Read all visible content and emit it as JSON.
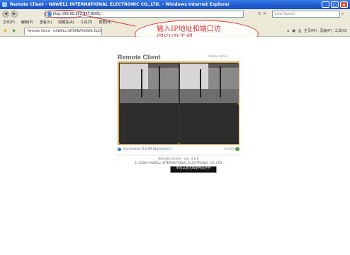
{
  "window": {
    "title": "Remote Client - HAWELL INTERNATIONAL ELECTRONIC CO.,LTD. - Windows Internet Explorer",
    "buttons": [
      "_",
      "□",
      "×"
    ]
  },
  "address": {
    "url": "http://58.60.252.247:8001/",
    "search_placeholder": "Live Search"
  },
  "menu": {
    "items": [
      "文件(F)",
      "编辑(E)",
      "查看(V)",
      "收藏夹(A)",
      "工具(T)",
      "帮助(H)"
    ]
  },
  "tab": {
    "label": "Remote Client - HAWELL INTERNATIONAL ELEC",
    "commands": [
      "主页(M)",
      "页面(P)",
      "工具(O)"
    ]
  },
  "annotation": {
    "line1": "输入IP地址和端口访",
    "line2": "问SVR主机。"
  },
  "page": {
    "title": "Remote Client",
    "links": "Admin  ⚙ Lo",
    "caption": "单击以激活和使用此控件",
    "status": "Connected [15.09 Kbytes/sec]",
    "install": "Install",
    "footer_line1": "Remote Client - ver. 3.0.0",
    "footer_line2": "© 2008 HAWELL INTERNATIONAL ELECTRONIC CO.,LTD."
  },
  "colors": {
    "titlebar": "#1f5bd0",
    "annotation": "#d23a3a",
    "video_border": "#d9a54a"
  }
}
